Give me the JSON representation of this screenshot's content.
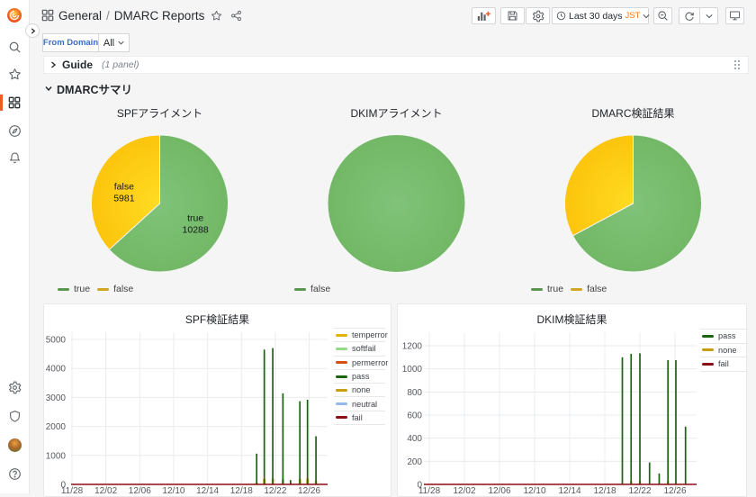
{
  "header": {
    "breadcrumb": {
      "section": "General",
      "separator": "/",
      "title": "DMARC Reports"
    },
    "toolbar": {
      "time_range": "Last 30 days",
      "timezone": "JST"
    }
  },
  "submenu": {
    "variable_label": "From Domain",
    "variable_value": "All"
  },
  "rows": {
    "guide": {
      "title": "Guide",
      "panel_count": "(1 panel)"
    },
    "summary": {
      "title": "DMARCサマリ"
    }
  },
  "colors": {
    "page_bg": "#f5f5f5",
    "pie_green": "#72b866",
    "pie_green_light": "#80c379",
    "pie_yellow": "#fcc40d",
    "pie_yellow_light": "#ffdc22",
    "legend_green": "#5b9650",
    "legend_yellow": "#cfa722",
    "accent_orange": "#f77b1b",
    "link_blue": "#3b6dc5"
  },
  "chart_data": [
    {
      "type": "pie",
      "title": "SPFアライメント",
      "show_labels": true,
      "slices": [
        {
          "label": "true",
          "value": 10288,
          "color_key": "green"
        },
        {
          "label": "false",
          "value": 5981,
          "color_key": "yellow"
        }
      ],
      "legend": [
        {
          "label": "true",
          "color": "#5b9650"
        },
        {
          "label": "false",
          "color": "#cfa722"
        }
      ]
    },
    {
      "type": "pie",
      "title": "DKIMアライメント",
      "show_labels": false,
      "slices": [
        {
          "label": "false",
          "fraction": 1.0,
          "color_key": "green"
        }
      ],
      "legend": [
        {
          "label": "false",
          "color": "#5b9650"
        }
      ]
    },
    {
      "type": "pie",
      "title": "DMARC検証結果",
      "show_labels": false,
      "slices": [
        {
          "label": "true",
          "fraction": 0.672,
          "color_key": "green"
        },
        {
          "label": "false",
          "fraction": 0.328,
          "color_key": "yellow"
        }
      ],
      "legend": [
        {
          "label": "true",
          "color": "#5b9650"
        },
        {
          "label": "false",
          "color": "#cfa722"
        }
      ]
    },
    {
      "type": "line",
      "title": "SPF検証結果",
      "ylim": [
        0,
        5000
      ],
      "yticks": [
        0,
        1000,
        2000,
        3000,
        4000,
        5000
      ],
      "xticks": [
        "11/28",
        "12/02",
        "12/06",
        "12/10",
        "12/14",
        "12/18",
        "12/22",
        "12/26"
      ],
      "x_unit": "days since 11/28",
      "legend": [
        {
          "label": "temperror",
          "color": "#e0b400"
        },
        {
          "label": "softfail",
          "color": "#96d98d"
        },
        {
          "label": "permerror",
          "color": "#d4500e"
        },
        {
          "label": "pass",
          "color": "#1a640f"
        },
        {
          "label": "none",
          "color": "#c79e12"
        },
        {
          "label": "neutral",
          "color": "#92b9e8"
        },
        {
          "label": "fail",
          "color": "#8b0e16"
        }
      ],
      "series": [
        {
          "name": "none",
          "color": "#c79e12",
          "width": 2.6,
          "points": [
            [
              21.8,
              60
            ],
            [
              22.7,
              190
            ],
            [
              23.7,
              200
            ],
            [
              24.9,
              170
            ],
            [
              26.9,
              190
            ],
            [
              27.8,
              200
            ],
            [
              28.8,
              120
            ]
          ]
        },
        {
          "name": "pass",
          "color": "#1a640f",
          "width": 1.7,
          "points": [
            [
              21.8,
              1060
            ],
            [
              22.7,
              4650
            ],
            [
              23.7,
              4700
            ],
            [
              24.9,
              3140
            ],
            [
              25.8,
              150
            ],
            [
              26.9,
              2870
            ],
            [
              27.8,
              2920
            ],
            [
              28.8,
              1660
            ]
          ]
        },
        {
          "name": "fail",
          "color": "#8b0e16",
          "width": 1.6,
          "baseline": 0,
          "points": [
            [
              25.8,
              60
            ]
          ]
        }
      ]
    },
    {
      "type": "line",
      "title": "DKIM検証結果",
      "ylim": [
        0,
        1200
      ],
      "yticks": [
        0,
        200,
        400,
        600,
        800,
        1000,
        1200
      ],
      "xticks": [
        "11/28",
        "12/02",
        "12/06",
        "12/10",
        "12/14",
        "12/18",
        "12/22",
        "12/26"
      ],
      "x_unit": "days since 11/28",
      "legend": [
        {
          "label": "pass",
          "color": "#1a640f"
        },
        {
          "label": "none",
          "color": "#c79e12"
        },
        {
          "label": "fail",
          "color": "#8b0e16"
        }
      ],
      "series": [
        {
          "name": "none",
          "color": "#c79e12",
          "width": 2.4,
          "points": [
            [
              23.0,
              25
            ],
            [
              24.0,
              30
            ],
            [
              27.2,
              28
            ]
          ]
        },
        {
          "name": "pass",
          "color": "#1a640f",
          "width": 1.7,
          "points": [
            [
              22.0,
              1100
            ],
            [
              23.0,
              1130
            ],
            [
              24.0,
              1135
            ],
            [
              25.1,
              190
            ],
            [
              26.2,
              95
            ],
            [
              27.2,
              1075
            ],
            [
              28.1,
              1075
            ],
            [
              29.2,
              500
            ]
          ]
        },
        {
          "name": "fail",
          "color": "#8b0e16",
          "width": 1.6,
          "baseline": 0,
          "points": []
        }
      ]
    }
  ]
}
